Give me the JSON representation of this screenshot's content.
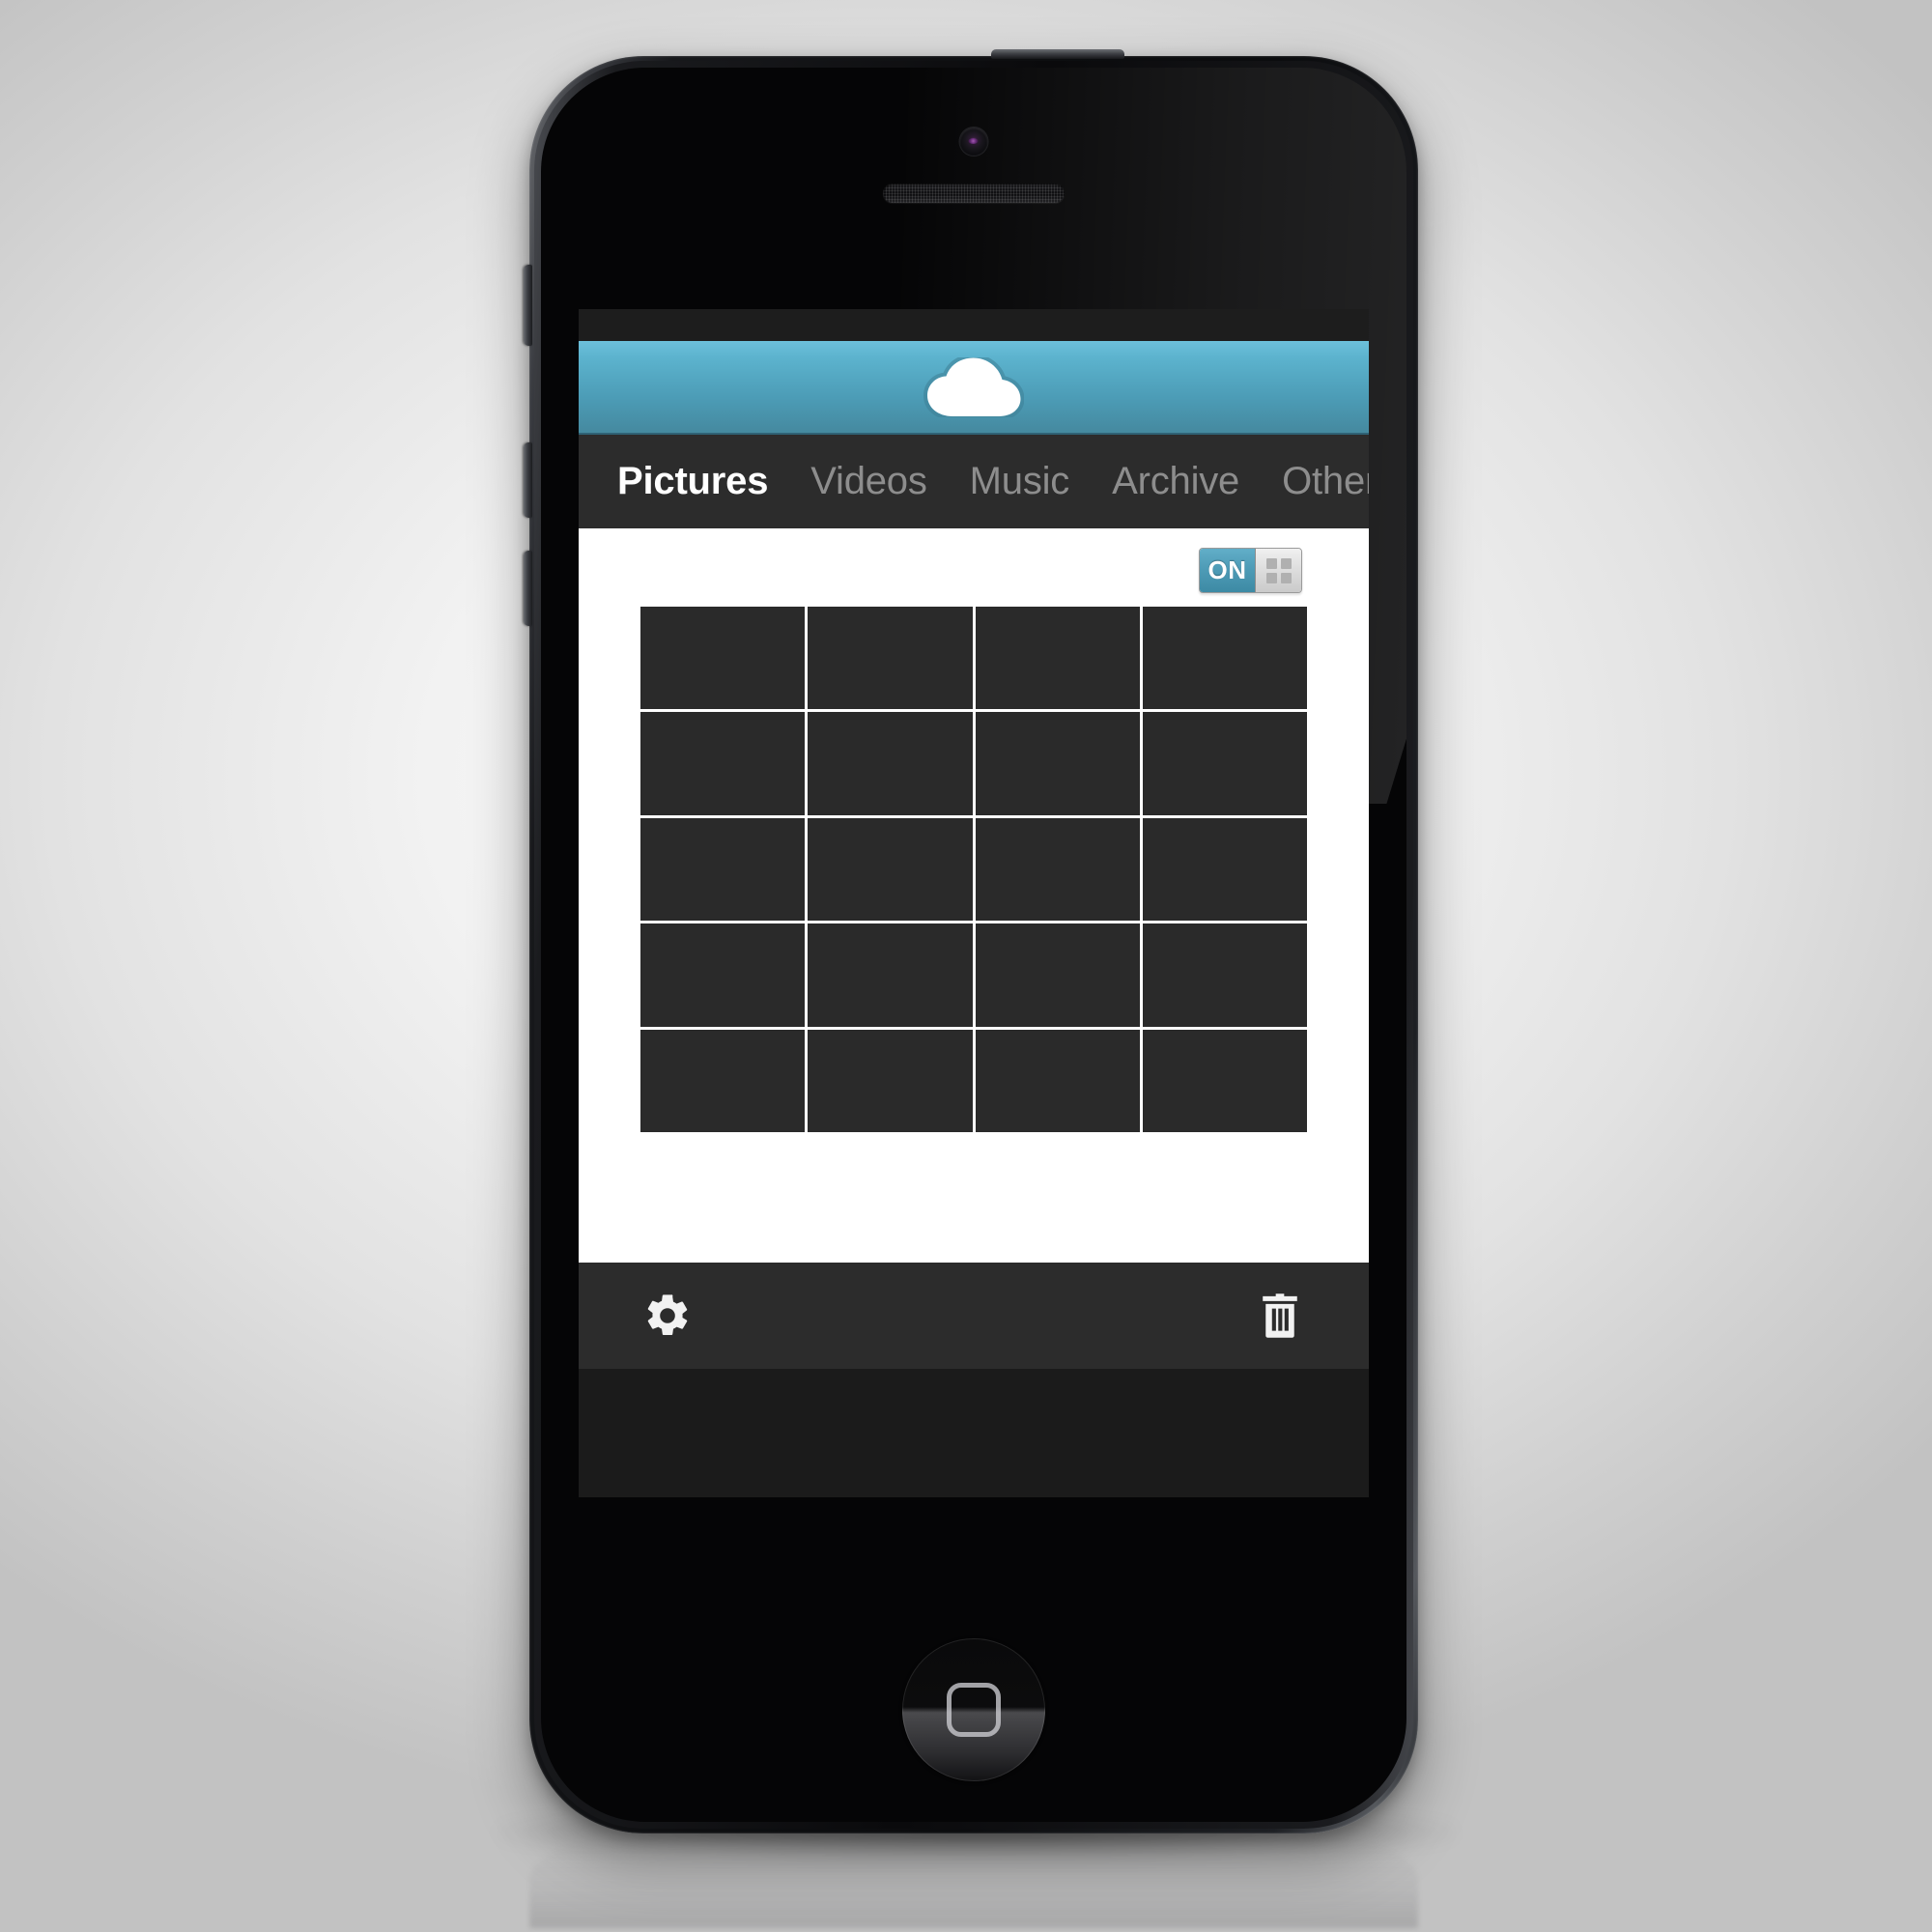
{
  "device": {
    "name": "smartphone-mockup",
    "front_camera": "front-camera",
    "earpiece": "earpiece-speaker",
    "home_button": "home-button",
    "buttons": {
      "power": "power-button",
      "mute": "mute-switch",
      "volume_up": "volume-up-button",
      "volume_down": "volume-down-button"
    }
  },
  "app": {
    "header": {
      "logo_icon": "cloud-icon",
      "background_color": "#4e9cb7"
    },
    "tabs": [
      {
        "label": "Pictures",
        "active": true
      },
      {
        "label": "Videos",
        "active": false
      },
      {
        "label": "Music",
        "active": false
      },
      {
        "label": "Archive",
        "active": false
      },
      {
        "label": "Others",
        "active": false
      }
    ],
    "toolbar": {
      "view_toggle": {
        "state_label": "ON",
        "knob_icon": "grid-view-icon",
        "accent_color": "#4e9cb7"
      }
    },
    "gallery": {
      "columns": 4,
      "rows": 5,
      "cell_count": 20,
      "cell_color": "#2a2a2a",
      "gap_color": "#ffffff"
    },
    "bottom_bar": {
      "settings_icon": "gear-icon",
      "delete_icon": "trash-icon",
      "background_color": "#2c2c2c"
    }
  }
}
